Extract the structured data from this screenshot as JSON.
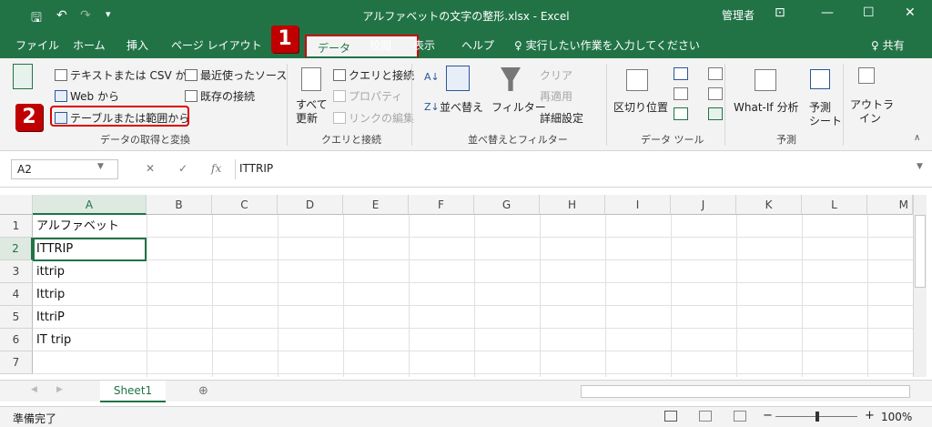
{
  "window": {
    "title": "アルファベットの文字の整形.xlsx - Excel",
    "user": "管理者",
    "save_icon": "🖫",
    "undo_icon": "↶",
    "redo_icon": "↷",
    "qat_more": "▾",
    "display_icon": "⊡",
    "minimize": "—",
    "maximize": "☐",
    "close": "✕"
  },
  "tabs": [
    "ファイル",
    "ホーム",
    "挿入",
    "ページ レイアウト",
    "データ",
    "校閲",
    "表示",
    "ヘルプ"
  ],
  "tellme": "♀ 実行したい作業を入力してください",
  "share": "♀ 共有",
  "ribbon": {
    "get_data": {
      "text_csv": "テキストまたは CSV から",
      "recent": "最近使ったソース",
      "web": "Web から",
      "existing": "既存の接続",
      "table_range": "テーブルまたは範囲から",
      "group": "データの取得と変換"
    },
    "queries": {
      "refresh": "すべて",
      "refresh2": "更新",
      "queries_conn": "クエリと接続",
      "properties": "プロパティ",
      "edit_links": "リンクの編集",
      "group": "クエリと接続"
    },
    "sort": {
      "sort": "並べ替え",
      "filter": "フィルター",
      "clear": "クリア",
      "reapply": "再適用",
      "advanced": "詳細設定",
      "group": "並べ替えとフィルター",
      "az": "A↓",
      "za": "Z↓"
    },
    "tools": {
      "text_to_cols": "区切り位置",
      "group": "データ ツール"
    },
    "forecast": {
      "whatif": "What-If 分析",
      "forecast": "予測",
      "sheet": "シート",
      "group": "予測"
    },
    "outline": {
      "label": "アウトラ",
      "label2": "イン"
    }
  },
  "badges": [
    "1",
    "2"
  ],
  "formula": {
    "cell": "A2",
    "fx": "fx",
    "cancel": "✕",
    "enter": "✓",
    "value": "ITTRIP"
  },
  "columns": [
    "A",
    "B",
    "C",
    "D",
    "E",
    "F",
    "G",
    "H",
    "I",
    "J",
    "K",
    "L",
    "M"
  ],
  "rows": [
    "1",
    "2",
    "3",
    "4",
    "5",
    "6",
    "7"
  ],
  "cells": [
    "アルファベット",
    "ITTRIP",
    "ittrip",
    "Ittrip",
    "IttriP",
    "IT trip",
    ""
  ],
  "sheet": {
    "name": "Sheet1",
    "add": "⊕",
    "nav_prev": "◀",
    "nav_next": "▶"
  },
  "status": {
    "ready": "準備完了",
    "zoom": "100%",
    "minus": "−",
    "plus": "+"
  }
}
